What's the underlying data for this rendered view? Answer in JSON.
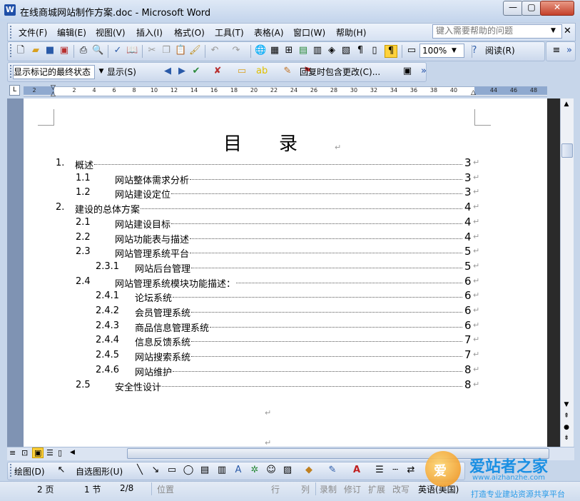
{
  "window": {
    "app_icon": "W",
    "title": "在线商城网站制作方案.doc - Microsoft Word",
    "minimize": "—",
    "maximize": "▢",
    "close": "✕"
  },
  "menu": {
    "items": [
      "文件(F)",
      "编辑(E)",
      "视图(V)",
      "插入(I)",
      "格式(O)",
      "工具(T)",
      "表格(A)",
      "窗口(W)",
      "帮助(H)"
    ],
    "help_placeholder": "键入需要帮助的问题",
    "doc_close": "✕"
  },
  "toolbar": {
    "zoom": "100%",
    "reading": "阅读(R)",
    "markup_state": "显示标记的最终状态",
    "show": "显示(S)",
    "reply_with_changes": "回复时包含更改(C)..."
  },
  "ruler": {
    "corner": "L",
    "ticks": [
      "2",
      "2",
      "4",
      "6",
      "8",
      "10",
      "12",
      "14",
      "16",
      "18",
      "20",
      "22",
      "24",
      "26",
      "28",
      "30",
      "32",
      "34",
      "36",
      "38",
      "40",
      "44",
      "46",
      "48"
    ]
  },
  "document": {
    "title_chars": [
      "目",
      "录"
    ],
    "para_mark": "↵",
    "toc": [
      {
        "num": "1.",
        "text": "概述",
        "page": "3",
        "level": 0
      },
      {
        "num": "1.1",
        "text": "网站整体需求分析",
        "page": "3",
        "level": 1
      },
      {
        "num": "1.2",
        "text": "网站建设定位",
        "page": "3",
        "level": 1
      },
      {
        "num": "2.",
        "text": "建设的总体方案",
        "page": "4",
        "level": 0
      },
      {
        "num": "2.1",
        "text": "网站建设目标",
        "page": "4",
        "level": 1
      },
      {
        "num": "2.2",
        "text": "网站功能表与描述",
        "page": "4",
        "level": 1
      },
      {
        "num": "2.3",
        "text": "网站管理系统平台",
        "page": "5",
        "level": 1
      },
      {
        "num": "2.3.1",
        "text": "网站后台管理",
        "page": "5",
        "level": 2
      },
      {
        "num": "2.4",
        "text": "网站管理系统模块功能描述：",
        "page": "6",
        "level": 1
      },
      {
        "num": "2.4.1",
        "text": "论坛系统",
        "page": "6",
        "level": 2
      },
      {
        "num": "2.4.2",
        "text": "会员管理系统",
        "page": "6",
        "level": 2
      },
      {
        "num": "2.4.3",
        "text": "商品信息管理系统",
        "page": "6",
        "level": 2
      },
      {
        "num": "2.4.4",
        "text": "信息反馈系统",
        "page": "7",
        "level": 2
      },
      {
        "num": "2.4.5",
        "text": "网站搜索系统",
        "page": "7",
        "level": 2
      },
      {
        "num": "2.4.6",
        "text": "网站维护",
        "page": "8",
        "level": 2
      },
      {
        "num": "2.5",
        "text": "安全性设计",
        "page": "8",
        "level": 1
      }
    ]
  },
  "drawing": {
    "draw": "绘图(D)",
    "autoshapes": "自选图形(U)"
  },
  "status": {
    "page": "2 页",
    "section": "1 节",
    "page_of": "2/8",
    "position": "位置",
    "line": "行",
    "column": "列",
    "rec": "录制",
    "trk": "修订",
    "ext": "扩展",
    "ovr": "改写",
    "language": "英语(美国)"
  },
  "watermark": {
    "logo_text": "爱",
    "title": "爱站者之家",
    "url": "www.aizhanzhe.com",
    "slogan": "打造专业建站资源共享平台"
  },
  "colors": {
    "frame": "#c7d6ea",
    "page": "#ffffff",
    "page_border": "#7f93b3",
    "watermark_blue": "#1a8fe3"
  }
}
